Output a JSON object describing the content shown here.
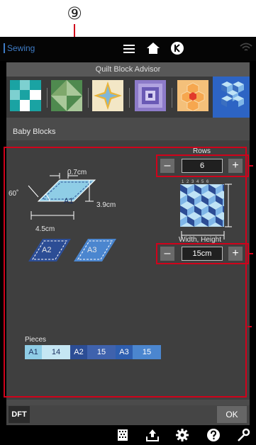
{
  "callout": {
    "number": "⑨"
  },
  "statusbar": {
    "app_label": "Sewing",
    "icons": [
      "menu-icon",
      "home-icon",
      "k-circle-icon",
      "wifi-icon"
    ]
  },
  "dialog": {
    "title": "Quilt Block Advisor",
    "thumbnails": [
      {
        "name": "teal-checker",
        "selected": false
      },
      {
        "name": "green-triangles",
        "selected": false
      },
      {
        "name": "star-quilt",
        "selected": false
      },
      {
        "name": "log-cabin",
        "selected": false
      },
      {
        "name": "hexagon-flower",
        "selected": false
      },
      {
        "name": "baby-blocks",
        "selected": true
      }
    ],
    "block_name": "Baby Blocks",
    "diagram": {
      "angle": "60˚",
      "seam": "0.7cm",
      "height": "3.9cm",
      "width": "4.5cm",
      "piece_main": "A1",
      "piece_2": "A2",
      "piece_3": "A3"
    },
    "rows": {
      "label": "Rows",
      "value": "6",
      "minus": "–",
      "plus": "+"
    },
    "preview": {
      "ruler": "1 2 3 4 5 6"
    },
    "size": {
      "label": "Width, Height",
      "value": "15cm",
      "minus": "–",
      "plus": "+"
    },
    "pieces": {
      "label": "Pieces",
      "items": [
        {
          "name": "A1",
          "count": "14"
        },
        {
          "name": "A2",
          "count": "15"
        },
        {
          "name": "A3",
          "count": "15"
        }
      ]
    },
    "dft_label": "DFT",
    "ok_label": "OK"
  },
  "footer_icons": [
    "pattern-icon",
    "upload-icon",
    "settings-icon",
    "help-icon",
    "wrench-icon"
  ],
  "colors": {
    "accent_blue": "#2d64c4",
    "annotation_red": "#d0021b",
    "a1_light": "#8fcde6",
    "a2_dark": "#2c4d95",
    "a3_mid": "#4b86cf"
  }
}
